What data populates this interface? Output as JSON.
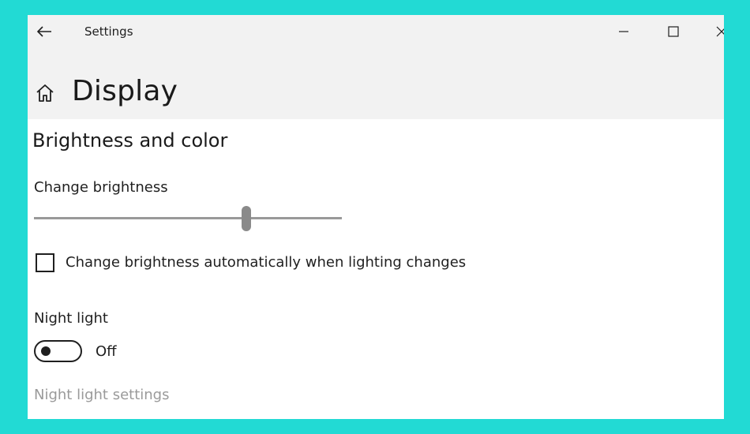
{
  "window": {
    "app_title": "Settings",
    "back_icon": "arrow-left-icon",
    "controls": {
      "minimize_icon": "minimize-icon",
      "maximize_icon": "maximize-icon",
      "close_icon": "close-icon"
    }
  },
  "header": {
    "home_icon": "home-icon",
    "page_title": "Display"
  },
  "brightness_section": {
    "title": "Brightness and color",
    "change_brightness_label": "Change brightness",
    "brightness_level": 0.69,
    "auto_brightness": {
      "label": "Change brightness automatically when lighting changes",
      "checked": false
    }
  },
  "night_light": {
    "label": "Night light",
    "state_text": "Off",
    "enabled": false,
    "settings_link": "Night light settings"
  },
  "colors": {
    "background_frame": "#22dad4",
    "header_bg": "#f2f2f2",
    "content_bg": "#ffffff",
    "disabled_link": "#9a9a9a"
  }
}
